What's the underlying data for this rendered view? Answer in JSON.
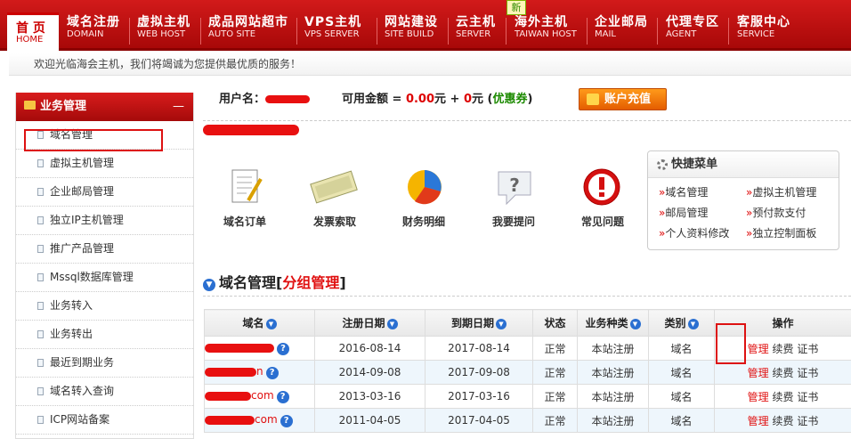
{
  "nav": {
    "home": {
      "cn": "首 页",
      "en": "HOME"
    },
    "items": [
      {
        "cn": "域名注册",
        "en": "DOMAIN"
      },
      {
        "cn": "虚拟主机",
        "en": "WEB HOST"
      },
      {
        "cn": "成品网站超市",
        "en": "AUTO SITE"
      },
      {
        "cn": "VPS主机",
        "en": "VPS SERVER"
      },
      {
        "cn": "网站建设",
        "en": "SITE BUILD"
      },
      {
        "cn": "云主机",
        "en": "SERVER"
      },
      {
        "cn": "海外主机",
        "en": "TAIWAN HOST"
      },
      {
        "cn": "企业邮局",
        "en": "MAIL"
      },
      {
        "cn": "代理专区",
        "en": "AGENT"
      },
      {
        "cn": "客服中心",
        "en": "SERVICE"
      }
    ],
    "new_badge": "新"
  },
  "welcome": "欢迎光临海会主机，我们将竭诚为您提供最优质的服务！",
  "sidebar": {
    "title": "业务管理",
    "collapse": "—",
    "items": [
      "域名管理",
      "虚拟主机管理",
      "企业邮局管理",
      "独立IP主机管理",
      "推广产品管理",
      "Mssql数据库管理",
      "业务转入",
      "业务转出",
      "最近到期业务",
      "域名转入查询",
      "ICP网站备案"
    ]
  },
  "account": {
    "username_label": "用户名：",
    "balance_label": "可用金额 = ",
    "amount": "0.00",
    "yuan1": "元 + ",
    "coupon_amount": "0",
    "yuan2": "元 (",
    "coupon_label": "优惠券",
    "close": ")",
    "recharge": "账户充值"
  },
  "quick_icons": [
    "域名订单",
    "发票索取",
    "财务明细",
    "我要提问",
    "常见问题"
  ],
  "quick_menu": {
    "title": "快捷菜单",
    "links": [
      "域名管理",
      "虚拟主机管理",
      "邮局管理",
      "预付款支付",
      "个人资料修改",
      "独立控制面板"
    ]
  },
  "section": {
    "title": "域名管理",
    "group": "分组管理",
    "lb": "[",
    "rb": "]"
  },
  "table": {
    "headers": [
      "域名",
      "注册日期",
      "到期日期",
      "状态",
      "业务种类",
      "类别",
      "操作"
    ],
    "rows": [
      {
        "suffix": "",
        "reg": "2016-08-14",
        "exp": "2017-08-14",
        "status": "正常",
        "kind": "本站注册",
        "cat": "域名",
        "manage": "管理",
        "renew": "续费",
        "cert": "证书"
      },
      {
        "suffix": "n",
        "reg": "2014-09-08",
        "exp": "2017-09-08",
        "status": "正常",
        "kind": "本站注册",
        "cat": "域名",
        "manage": "管理",
        "renew": "续费",
        "cert": "证书"
      },
      {
        "suffix": "com",
        "reg": "2013-03-16",
        "exp": "2017-03-16",
        "status": "正常",
        "kind": "本站注册",
        "cat": "域名",
        "manage": "管理",
        "renew": "续费",
        "cert": "证书"
      },
      {
        "suffix": "com",
        "reg": "2011-04-05",
        "exp": "2017-04-05",
        "status": "正常",
        "kind": "本站注册",
        "cat": "域名",
        "manage": "管理",
        "renew": "续费",
        "cert": "证书"
      }
    ]
  },
  "colors": {
    "brand_red": "#c00",
    "link_red": "#e01010",
    "accent_blue": "#2a6fd1",
    "recharge_orange": "#f07800"
  }
}
